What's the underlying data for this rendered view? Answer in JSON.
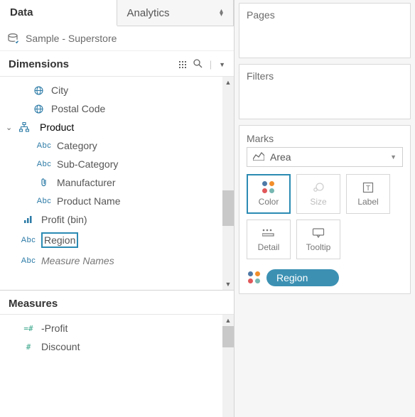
{
  "tabs": {
    "data": "Data",
    "analytics": "Analytics"
  },
  "datasource": "Sample - Superstore",
  "sections": {
    "dimensions": "Dimensions",
    "measures": "Measures"
  },
  "fields": {
    "city": "City",
    "postal_code": "Postal Code",
    "product": "Product",
    "category": "Category",
    "sub_category": "Sub-Category",
    "manufacturer": "Manufacturer",
    "product_name": "Product Name",
    "profit_bin": "Profit (bin)",
    "region": "Region",
    "measure_names": "Measure Names",
    "neg_profit": "-Profit",
    "discount": "Discount"
  },
  "shelves": {
    "pages": "Pages",
    "filters": "Filters",
    "marks": "Marks"
  },
  "markType": "Area",
  "cards": {
    "color": "Color",
    "size": "Size",
    "label": "Label",
    "detail": "Detail",
    "tooltip": "Tooltip"
  },
  "colorPill": "Region"
}
